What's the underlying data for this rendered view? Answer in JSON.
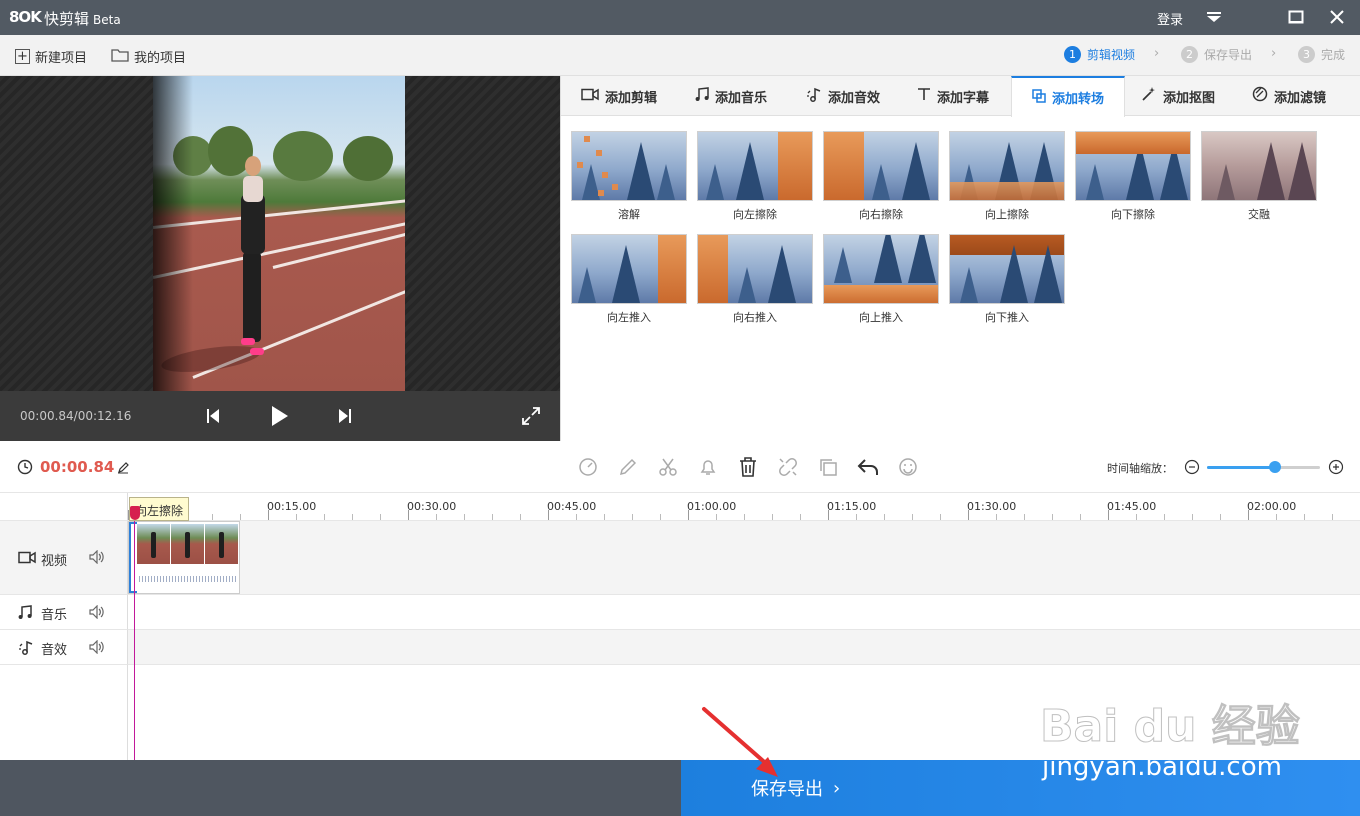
{
  "titlebar": {
    "logo": "8OK",
    "app_name": "快剪辑",
    "app_beta": "Beta",
    "login": "登录"
  },
  "toolbar": {
    "new_project": "新建项目",
    "my_projects": "我的项目",
    "steps": [
      {
        "num": "1",
        "label": "剪辑视频",
        "active": true
      },
      {
        "num": "2",
        "label": "保存导出",
        "active": false
      },
      {
        "num": "3",
        "label": "完成",
        "active": false
      }
    ]
  },
  "player": {
    "time_readout": "00:00.84/00:12.16"
  },
  "tabs": [
    {
      "label": "添加剪辑",
      "icon": "video-camera-icon"
    },
    {
      "label": "添加音乐",
      "icon": "music-note-icon"
    },
    {
      "label": "添加音效",
      "icon": "sound-effect-icon"
    },
    {
      "label": "添加字幕",
      "icon": "text-icon"
    },
    {
      "label": "添加转场",
      "icon": "transition-icon",
      "active": true
    },
    {
      "label": "添加抠图",
      "icon": "magic-wand-icon"
    },
    {
      "label": "添加滤镜",
      "icon": "filter-icon"
    }
  ],
  "transitions": [
    {
      "label": "溶解"
    },
    {
      "label": "向左擦除"
    },
    {
      "label": "向右擦除"
    },
    {
      "label": "向上擦除"
    },
    {
      "label": "向下擦除"
    },
    {
      "label": "交融"
    },
    {
      "label": "向左推入"
    },
    {
      "label": "向右推入"
    },
    {
      "label": "向上推入"
    },
    {
      "label": "向下推入"
    }
  ],
  "editor": {
    "current_time": "00:00.84",
    "zoom_label": "时间轴缩放：",
    "zoom_level": 0.6
  },
  "ruler": {
    "labels": [
      "00:15.00",
      "00:30.00",
      "00:45.00",
      "01:00.00",
      "01:15.00",
      "01:30.00",
      "01:45.00",
      "02:00.00"
    ]
  },
  "tracks": {
    "video": "视频",
    "music": "音乐",
    "sfx": "音效"
  },
  "clip": {
    "tooltip": "向左擦除"
  },
  "export": {
    "label": "保存导出"
  },
  "watermark": {
    "top": "Bai du 经验",
    "bottom": "jingyan.baidu.com"
  }
}
